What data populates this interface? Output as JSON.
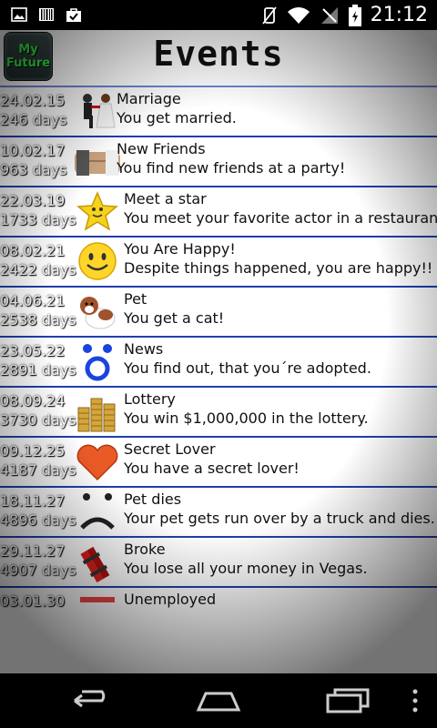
{
  "status": {
    "time": "21:12"
  },
  "header": {
    "logo_line1": "My",
    "logo_line2": "Future",
    "title": "Events"
  },
  "units": {
    "days": "days"
  },
  "events": [
    {
      "date": "24.02.15",
      "days": "246",
      "title": "Marriage",
      "desc": "You get married.",
      "icon": "proposal-icon"
    },
    {
      "date": "10.02.17",
      "days": "963",
      "title": "New Friends",
      "desc": "You find new friends at a party!",
      "icon": "handshake-icon"
    },
    {
      "date": "22.03.19",
      "days": "1733",
      "title": "Meet a star",
      "desc": "You meet your favorite actor in a restaurant!",
      "icon": "star-icon"
    },
    {
      "date": "08.02.21",
      "days": "2422",
      "title": "You Are Happy!",
      "desc": "Despite things happened, you are happy!!",
      "icon": "smiley-icon"
    },
    {
      "date": "04.06.21",
      "days": "2538",
      "title": "Pet",
      "desc": "You get a cat!",
      "icon": "dog-icon"
    },
    {
      "date": "23.05.22",
      "days": "2891",
      "title": "News",
      "desc": "You find out, that you´re adopted.",
      "icon": "surprised-face-icon"
    },
    {
      "date": "08.09.24",
      "days": "3730",
      "title": "Lottery",
      "desc": "You win $1,000,000 in the lottery.",
      "icon": "coins-icon"
    },
    {
      "date": "09.12.25",
      "days": "4187",
      "title": "Secret Lover",
      "desc": "You have a secret lover!",
      "icon": "heart-icon"
    },
    {
      "date": "18.11.27",
      "days": "4896",
      "title": "Pet dies",
      "desc": "Your pet gets run over by a truck and dies.",
      "icon": "sad-face-icon"
    },
    {
      "date": "29.11.27",
      "days": "4907",
      "title": "Broke",
      "desc": "You lose all your money in Vegas.",
      "icon": "dynamite-icon"
    },
    {
      "date": "03.01.30",
      "days": "",
      "title": "Unemployed",
      "desc": "",
      "icon": "unemployed-icon"
    }
  ],
  "colors": {
    "divider": "#1f3fae",
    "logo_text": "#39f04a"
  }
}
